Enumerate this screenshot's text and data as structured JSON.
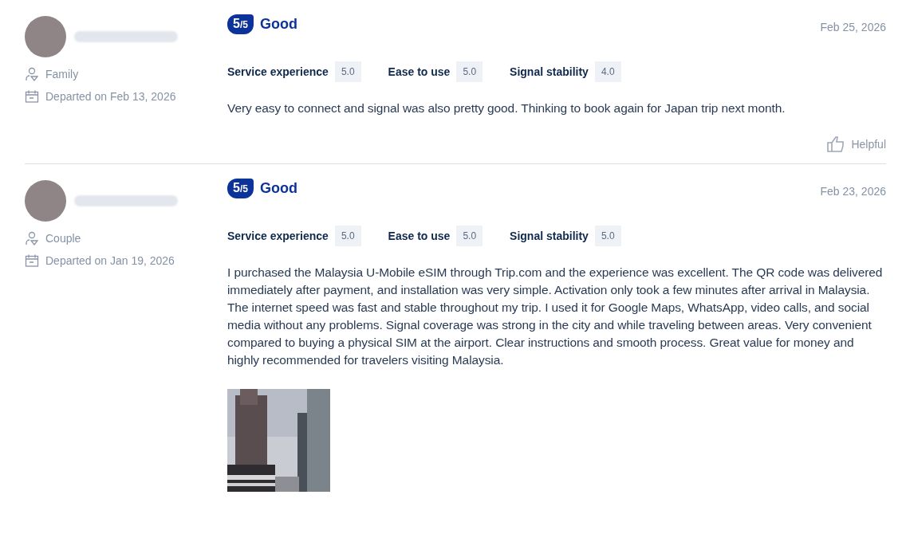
{
  "reviews": [
    {
      "traveler_type": "Family",
      "departed": "Departed on Feb 13, 2026",
      "score": "5",
      "score_max": "/5",
      "verdict": "Good",
      "date": "Feb 25, 2026",
      "ratings": [
        {
          "label": "Service experience",
          "value": "5.0"
        },
        {
          "label": "Ease to use",
          "value": "5.0"
        },
        {
          "label": "Signal stability",
          "value": "4.0"
        }
      ],
      "text": "Very easy to connect and signal was also pretty good. Thinking to book again for Japan trip next month.",
      "helpful": "Helpful"
    },
    {
      "traveler_type": "Couple",
      "departed": "Departed on Jan 19, 2026",
      "score": "5",
      "score_max": "/5",
      "verdict": "Good",
      "date": "Feb 23, 2026",
      "ratings": [
        {
          "label": "Service experience",
          "value": "5.0"
        },
        {
          "label": "Ease to use",
          "value": "5.0"
        },
        {
          "label": "Signal stability",
          "value": "5.0"
        }
      ],
      "text": "I purchased the Malaysia U-Mobile eSIM through Trip.com and the experience was excellent. The QR code was delivered immediately after payment, and installation was very simple. Activation only took a few minutes after arrival in Malaysia. The internet speed was fast and stable throughout my trip. I used it for Google Maps, WhatsApp, video calls, and social media without any problems. Signal coverage was strong in the city and while traveling between areas. Very convenient compared to buying a physical SIM at the airport. Clear instructions and smooth process. Great value for money and highly recommended for travelers visiting Malaysia."
    }
  ]
}
